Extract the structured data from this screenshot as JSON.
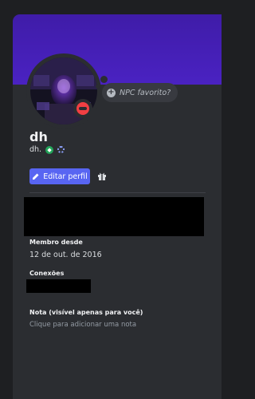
{
  "profile": {
    "display_name": "dh",
    "username": "dh.",
    "status": "dnd",
    "npc_bubble": "NPC favorito?",
    "edit_button": "Editar perfil",
    "member_since_label": "Membro desde",
    "member_since": "12 de out. de 2016",
    "connections_label": "Conexões",
    "note_label": "Nota (visível apenas para você)",
    "note_placeholder": "Clique para adicionar uma nota"
  },
  "colors": {
    "background": "#1e1f22",
    "card": "#2b2d31",
    "banner": "#4a22c2",
    "accent": "#5865f2",
    "dnd": "#f23f43",
    "badge_green": "#23a55a"
  },
  "icons": {
    "bubble": "plus-circle-icon",
    "edit": "pencil-icon",
    "gift": "gift-icon",
    "status": "do-not-disturb-icon"
  }
}
